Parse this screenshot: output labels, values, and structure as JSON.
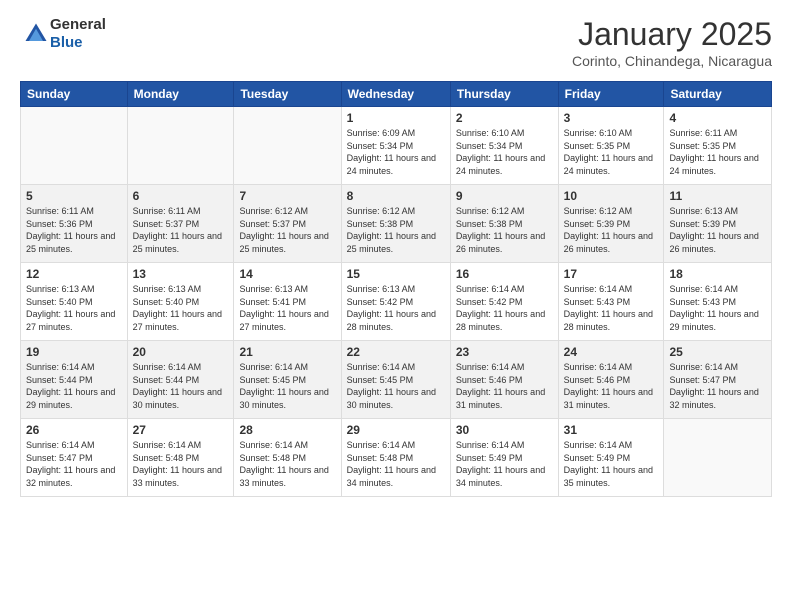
{
  "header": {
    "logo_general": "General",
    "logo_blue": "Blue",
    "title": "January 2025",
    "subtitle": "Corinto, Chinandega, Nicaragua"
  },
  "days_header": [
    "Sunday",
    "Monday",
    "Tuesday",
    "Wednesday",
    "Thursday",
    "Friday",
    "Saturday"
  ],
  "weeks": [
    {
      "alt": false,
      "days": [
        {
          "num": "",
          "info": ""
        },
        {
          "num": "",
          "info": ""
        },
        {
          "num": "",
          "info": ""
        },
        {
          "num": "1",
          "info": "Sunrise: 6:09 AM\nSunset: 5:34 PM\nDaylight: 11 hours and 24 minutes."
        },
        {
          "num": "2",
          "info": "Sunrise: 6:10 AM\nSunset: 5:34 PM\nDaylight: 11 hours and 24 minutes."
        },
        {
          "num": "3",
          "info": "Sunrise: 6:10 AM\nSunset: 5:35 PM\nDaylight: 11 hours and 24 minutes."
        },
        {
          "num": "4",
          "info": "Sunrise: 6:11 AM\nSunset: 5:35 PM\nDaylight: 11 hours and 24 minutes."
        }
      ]
    },
    {
      "alt": true,
      "days": [
        {
          "num": "5",
          "info": "Sunrise: 6:11 AM\nSunset: 5:36 PM\nDaylight: 11 hours and 25 minutes."
        },
        {
          "num": "6",
          "info": "Sunrise: 6:11 AM\nSunset: 5:37 PM\nDaylight: 11 hours and 25 minutes."
        },
        {
          "num": "7",
          "info": "Sunrise: 6:12 AM\nSunset: 5:37 PM\nDaylight: 11 hours and 25 minutes."
        },
        {
          "num": "8",
          "info": "Sunrise: 6:12 AM\nSunset: 5:38 PM\nDaylight: 11 hours and 25 minutes."
        },
        {
          "num": "9",
          "info": "Sunrise: 6:12 AM\nSunset: 5:38 PM\nDaylight: 11 hours and 26 minutes."
        },
        {
          "num": "10",
          "info": "Sunrise: 6:12 AM\nSunset: 5:39 PM\nDaylight: 11 hours and 26 minutes."
        },
        {
          "num": "11",
          "info": "Sunrise: 6:13 AM\nSunset: 5:39 PM\nDaylight: 11 hours and 26 minutes."
        }
      ]
    },
    {
      "alt": false,
      "days": [
        {
          "num": "12",
          "info": "Sunrise: 6:13 AM\nSunset: 5:40 PM\nDaylight: 11 hours and 27 minutes."
        },
        {
          "num": "13",
          "info": "Sunrise: 6:13 AM\nSunset: 5:40 PM\nDaylight: 11 hours and 27 minutes."
        },
        {
          "num": "14",
          "info": "Sunrise: 6:13 AM\nSunset: 5:41 PM\nDaylight: 11 hours and 27 minutes."
        },
        {
          "num": "15",
          "info": "Sunrise: 6:13 AM\nSunset: 5:42 PM\nDaylight: 11 hours and 28 minutes."
        },
        {
          "num": "16",
          "info": "Sunrise: 6:14 AM\nSunset: 5:42 PM\nDaylight: 11 hours and 28 minutes."
        },
        {
          "num": "17",
          "info": "Sunrise: 6:14 AM\nSunset: 5:43 PM\nDaylight: 11 hours and 28 minutes."
        },
        {
          "num": "18",
          "info": "Sunrise: 6:14 AM\nSunset: 5:43 PM\nDaylight: 11 hours and 29 minutes."
        }
      ]
    },
    {
      "alt": true,
      "days": [
        {
          "num": "19",
          "info": "Sunrise: 6:14 AM\nSunset: 5:44 PM\nDaylight: 11 hours and 29 minutes."
        },
        {
          "num": "20",
          "info": "Sunrise: 6:14 AM\nSunset: 5:44 PM\nDaylight: 11 hours and 30 minutes."
        },
        {
          "num": "21",
          "info": "Sunrise: 6:14 AM\nSunset: 5:45 PM\nDaylight: 11 hours and 30 minutes."
        },
        {
          "num": "22",
          "info": "Sunrise: 6:14 AM\nSunset: 5:45 PM\nDaylight: 11 hours and 30 minutes."
        },
        {
          "num": "23",
          "info": "Sunrise: 6:14 AM\nSunset: 5:46 PM\nDaylight: 11 hours and 31 minutes."
        },
        {
          "num": "24",
          "info": "Sunrise: 6:14 AM\nSunset: 5:46 PM\nDaylight: 11 hours and 31 minutes."
        },
        {
          "num": "25",
          "info": "Sunrise: 6:14 AM\nSunset: 5:47 PM\nDaylight: 11 hours and 32 minutes."
        }
      ]
    },
    {
      "alt": false,
      "days": [
        {
          "num": "26",
          "info": "Sunrise: 6:14 AM\nSunset: 5:47 PM\nDaylight: 11 hours and 32 minutes."
        },
        {
          "num": "27",
          "info": "Sunrise: 6:14 AM\nSunset: 5:48 PM\nDaylight: 11 hours and 33 minutes."
        },
        {
          "num": "28",
          "info": "Sunrise: 6:14 AM\nSunset: 5:48 PM\nDaylight: 11 hours and 33 minutes."
        },
        {
          "num": "29",
          "info": "Sunrise: 6:14 AM\nSunset: 5:48 PM\nDaylight: 11 hours and 34 minutes."
        },
        {
          "num": "30",
          "info": "Sunrise: 6:14 AM\nSunset: 5:49 PM\nDaylight: 11 hours and 34 minutes."
        },
        {
          "num": "31",
          "info": "Sunrise: 6:14 AM\nSunset: 5:49 PM\nDaylight: 11 hours and 35 minutes."
        },
        {
          "num": "",
          "info": ""
        }
      ]
    }
  ]
}
